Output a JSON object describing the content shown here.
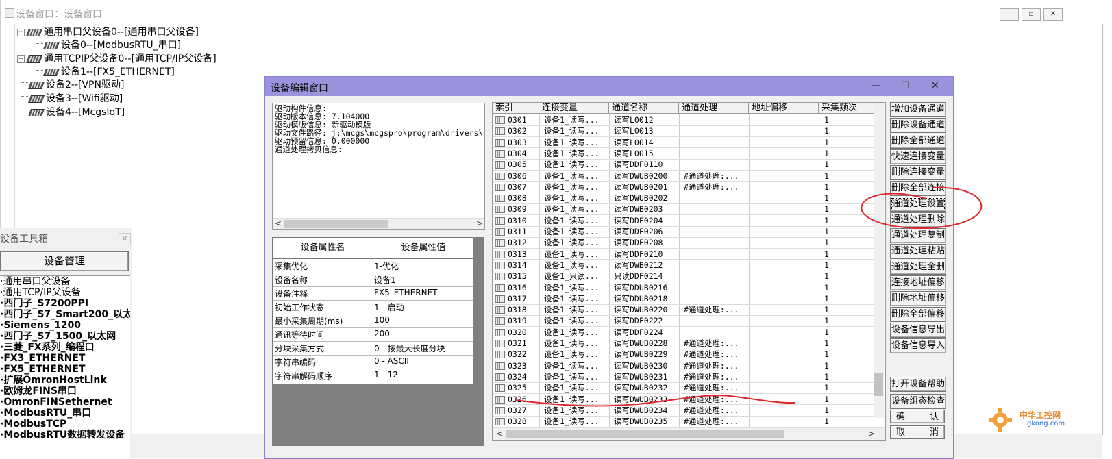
{
  "outer_window": {
    "title": "设备窗口：设备窗口",
    "controls": [
      "—",
      "▫",
      "✕"
    ],
    "tree": [
      {
        "label": "通用串口父设备0--[通用串口父设备]",
        "level": 0,
        "expander": "−"
      },
      {
        "label": "设备0--[ModbusRTU_串口]",
        "level": 1
      },
      {
        "label": "通用TCPIP父设备0--[通用TCP/IP父设备]",
        "level": 0,
        "expander": "−"
      },
      {
        "label": "设备1--[FX5_ETHERNET]",
        "level": 1
      },
      {
        "label": "设备2--[VPN驱动]",
        "level": 0
      },
      {
        "label": "设备3--[Wifi驱动]",
        "level": 0
      },
      {
        "label": "设备4--[McgsIoT]",
        "level": 0
      }
    ]
  },
  "toolbox": {
    "title": "设备工具箱",
    "manage_button": "设备管理",
    "items": [
      "通用串口父设备",
      "通用TCP/IP父设备",
      "西门子_S7200PPI",
      "西门子_S7_Smart200_以太网",
      "Siemens_1200",
      "西门子_S7_1500_以太网",
      "三菱_FX系列_编程口",
      "FX3_ETHERNET",
      "FX5_ETHERNET",
      "扩展OmronHostLink",
      "欧姆龙FINS串口",
      "OmronFINSethernet",
      "ModbusRTU_串口",
      "ModbusTCP",
      "ModbusRTU数据转发设备"
    ]
  },
  "dialog": {
    "title": "设备编辑窗口",
    "controls": [
      "—",
      "☐",
      "✕"
    ],
    "info_lines": [
      "驱动构件信息:",
      "驱动版本信息: 7.104000",
      "驱动模版信息: 新驱动模版",
      "驱动文件路径: j:\\mcgs\\mcgspro\\program\\drivers\\p",
      "驱动预留信息: 0.000000",
      "通道处理拷贝信息:"
    ],
    "props": {
      "headers": [
        "设备属性名",
        "设备属性值"
      ],
      "rows": [
        [
          "采集优化",
          "1-优化"
        ],
        [
          "设备名称",
          "设备1"
        ],
        [
          "设备注释",
          "FX5_ETHERNET"
        ],
        [
          "初始工作状态",
          "1 - 启动"
        ],
        [
          "最小采集周期(ms)",
          "100"
        ],
        [
          "通讯等待时间",
          "200"
        ],
        [
          "分块采集方式",
          "0 - 按最大长度分块"
        ],
        [
          "字符串编码",
          "0 - ASCII"
        ],
        [
          "字符串解码顺序",
          "1 - 12"
        ]
      ]
    },
    "grid": {
      "headers": [
        "索引",
        "连接变量",
        "通道名称",
        "通道处理",
        "地址偏移",
        "采集频次"
      ],
      "rows": [
        [
          "0301",
          "设备1_读写...",
          "读写L0012",
          "",
          "",
          "1"
        ],
        [
          "0302",
          "设备1_读写...",
          "读写L0013",
          "",
          "",
          "1"
        ],
        [
          "0303",
          "设备1_读写...",
          "读写L0014",
          "",
          "",
          "1"
        ],
        [
          "0304",
          "设备1_读写...",
          "读写L0015",
          "",
          "",
          "1"
        ],
        [
          "0305",
          "设备1_读写...",
          "读写DDF0110",
          "",
          "",
          "1"
        ],
        [
          "0306",
          "设备1_读写...",
          "读写DWUB0200",
          "#通道处理:...",
          "",
          "1"
        ],
        [
          "0307",
          "设备1_读写...",
          "读写DWUB0201",
          "#通道处理:...",
          "",
          "1"
        ],
        [
          "0308",
          "设备1_读写...",
          "读写DWUB0202",
          "",
          "",
          "1"
        ],
        [
          "0309",
          "设备1_读写...",
          "读写DWB0203",
          "",
          "",
          "1"
        ],
        [
          "0310",
          "设备1_读写...",
          "读写DDF0204",
          "",
          "",
          "1"
        ],
        [
          "0311",
          "设备1_读写...",
          "读写DDF0206",
          "",
          "",
          "1"
        ],
        [
          "0312",
          "设备1_读写...",
          "读写DDF0208",
          "",
          "",
          "1"
        ],
        [
          "0313",
          "设备1_读写...",
          "读写DDF0210",
          "",
          "",
          "1"
        ],
        [
          "0314",
          "设备1_读写...",
          "读写DWB0212",
          "",
          "",
          "1"
        ],
        [
          "0315",
          "设备1_只读...",
          "只读DDF0214",
          "",
          "",
          "1"
        ],
        [
          "0316",
          "设备1_读写...",
          "读写DDUB0216",
          "",
          "",
          "1"
        ],
        [
          "0317",
          "设备1_读写...",
          "读写DDUB0218",
          "",
          "",
          "1"
        ],
        [
          "0318",
          "设备1_读写...",
          "读写DWUB0220",
          "#通道处理:...",
          "",
          "1"
        ],
        [
          "0319",
          "设备1_读写...",
          "读写DDF0222",
          "",
          "",
          "1"
        ],
        [
          "0320",
          "设备1_读写...",
          "读写DDF0224",
          "",
          "",
          "1"
        ],
        [
          "0321",
          "设备1_读写...",
          "读写DWUB0228",
          "#通道处理:...",
          "",
          "1"
        ],
        [
          "0322",
          "设备1_读写...",
          "读写DWUB0229",
          "#通道处理:...",
          "",
          "1"
        ],
        [
          "0323",
          "设备1_读写...",
          "读写DWUB0230",
          "#通道处理:...",
          "",
          "1"
        ],
        [
          "0324",
          "设备1_读写...",
          "读写DWUB0231",
          "#通道处理:...",
          "",
          "1"
        ],
        [
          "0325",
          "设备1_读写...",
          "读写DWUB0232",
          "#通道处理:...",
          "",
          "1"
        ],
        [
          "0326",
          "设备1_读写...",
          "读写DWUB0233",
          "#通道处理:...",
          "",
          "1"
        ],
        [
          "0327",
          "设备1_读写...",
          "读写DWUB0234",
          "#通道处理:...",
          "",
          "1"
        ],
        [
          "0328",
          "设备1_读写...",
          "读写DWUB0235",
          "#通道处理:...",
          "",
          "1"
        ]
      ]
    },
    "side_buttons": [
      "增加设备通道",
      "删除设备通道",
      "删除全部通道",
      "快速连接变量",
      "删除连接变量",
      "删除全部连接",
      "通道处理设置",
      "通道处理删除",
      "通道处理复制",
      "通道处理粘贴",
      "通道处理全删",
      "连接地址偏移",
      "删除地址偏移",
      "删除全部偏移",
      "设备信息导出",
      "设备信息导入"
    ],
    "bottom_buttons": [
      "打开设备帮助",
      "设备组态检查",
      "确　　认",
      "取　　消"
    ]
  },
  "watermark": {
    "brand": "中华工控网",
    "domain": "gkong.com"
  },
  "colors": {
    "dialog_title": "#9b93dc",
    "annotation": "#e0262a"
  }
}
